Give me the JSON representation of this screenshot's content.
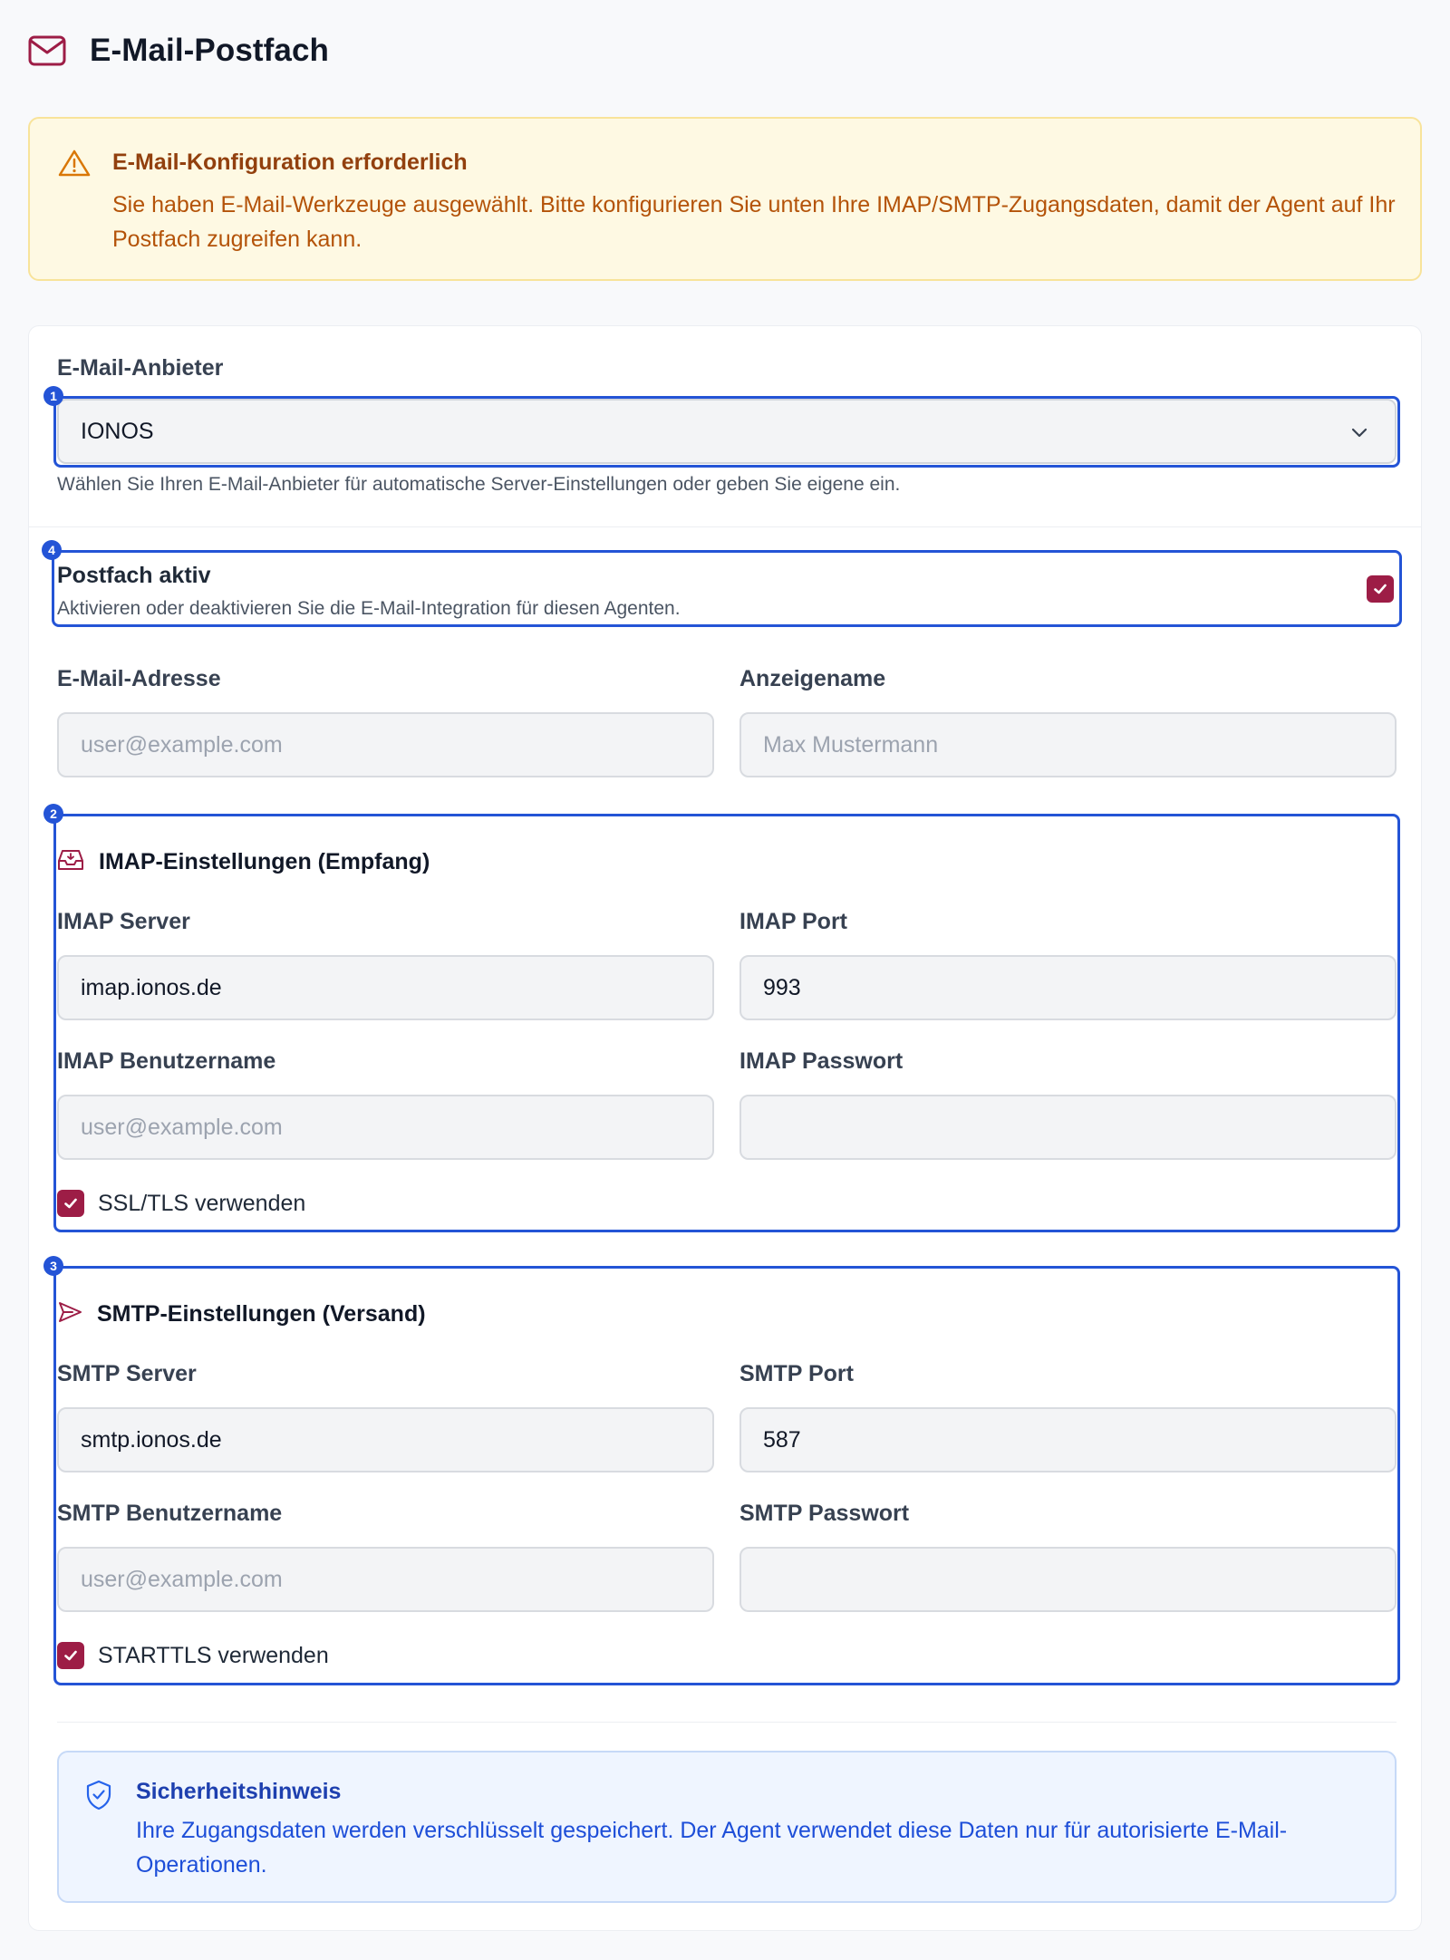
{
  "header": {
    "title": "E-Mail-Postfach",
    "icon": "mail-icon"
  },
  "alert": {
    "icon": "warning-triangle-icon",
    "title": "E-Mail-Konfiguration erforderlich",
    "text": "Sie haben E-Mail-Werkzeuge ausgewählt. Bitte konfigurieren Sie unten Ihre IMAP/SMTP-Zugangsdaten, damit der Agent auf Ihr Postfach zugreifen kann."
  },
  "provider": {
    "label": "E-Mail-Anbieter",
    "value": "IONOS",
    "help": "Wählen Sie Ihren E-Mail-Anbieter für automatische Server-Einstellungen oder geben Sie eigene ein."
  },
  "mailbox_active": {
    "title": "Postfach aktiv",
    "description": "Aktivieren oder deaktivieren Sie die E-Mail-Integration für diesen Agenten.",
    "checked": true
  },
  "email_address": {
    "label": "E-Mail-Adresse",
    "value": "",
    "placeholder": "user@example.com"
  },
  "display_name": {
    "label": "Anzeigename",
    "value": "",
    "placeholder": "Max Mustermann"
  },
  "imap": {
    "title": "IMAP-Einstellungen (Empfang)",
    "icon": "inbox-icon",
    "server": {
      "label": "IMAP Server",
      "value": "imap.ionos.de"
    },
    "port": {
      "label": "IMAP Port",
      "value": "993"
    },
    "username": {
      "label": "IMAP Benutzername",
      "value": "",
      "placeholder": "user@example.com"
    },
    "password": {
      "label": "IMAP Passwort",
      "value": ""
    },
    "ssl": {
      "label": "SSL/TLS verwenden",
      "checked": true
    }
  },
  "smtp": {
    "title": "SMTP-Einstellungen (Versand)",
    "icon": "send-icon",
    "server": {
      "label": "SMTP Server",
      "value": "smtp.ionos.de"
    },
    "port": {
      "label": "SMTP Port",
      "value": "587"
    },
    "username": {
      "label": "SMTP Benutzername",
      "value": "",
      "placeholder": "user@example.com"
    },
    "password": {
      "label": "SMTP Passwort",
      "value": ""
    },
    "starttls": {
      "label": "STARTTLS verwenden",
      "checked": true
    }
  },
  "security_note": {
    "icon": "shield-check-icon",
    "title": "Sicherheitshinweis",
    "text": "Ihre Zugangsdaten werden verschlüsselt gespeichert. Der Agent verwendet diese Daten nur für autorisierte E-Mail-Operationen."
  },
  "annotations": {
    "badge_1": "1",
    "badge_2": "2",
    "badge_3": "3",
    "badge_4": "4"
  },
  "colors": {
    "accent": "#9d1d46",
    "highlight": "#2454d6",
    "warning_text": "#b45309",
    "info_text": "#1d4ed8"
  }
}
